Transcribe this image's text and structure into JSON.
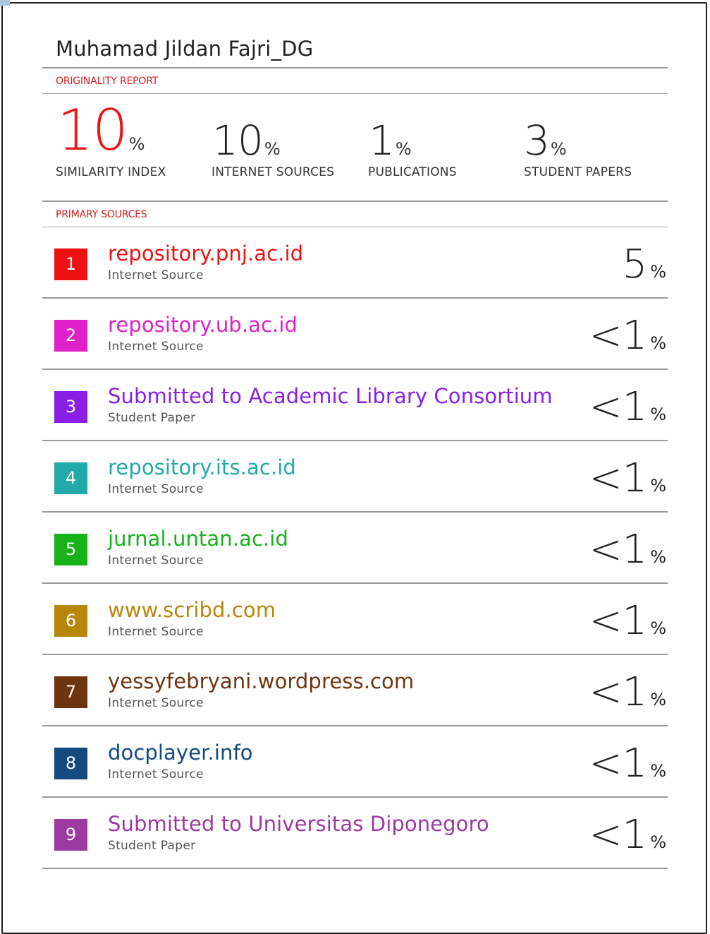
{
  "title": "Muhamad Jildan Fajri_DG",
  "originality_label": "ORIGINALITY REPORT",
  "stats": [
    {
      "value": "10",
      "unit": "%",
      "label": "SIMILARITY INDEX"
    },
    {
      "value": "10",
      "unit": "%",
      "label": "INTERNET SOURCES"
    },
    {
      "value": "1",
      "unit": "%",
      "label": "PUBLICATIONS"
    },
    {
      "value": "3",
      "unit": "%",
      "label": "STUDENT PAPERS"
    }
  ],
  "primary_label": "PRIMARY SOURCES",
  "sources": [
    {
      "num": "1",
      "name": "repository.pnj.ac.id",
      "type": "Internet Source",
      "value": "5",
      "unit": "%",
      "color": "#ee1111"
    },
    {
      "num": "2",
      "name": "repository.ub.ac.id",
      "type": "Internet Source",
      "value": "<1",
      "unit": "%",
      "color": "#e020c8"
    },
    {
      "num": "3",
      "name": "Submitted to Academic Library Consortium",
      "type": "Student Paper",
      "value": "<1",
      "unit": "%",
      "color": "#8a1ee6"
    },
    {
      "num": "4",
      "name": "repository.its.ac.id",
      "type": "Internet Source",
      "value": "<1",
      "unit": "%",
      "color": "#22aaaa"
    },
    {
      "num": "5",
      "name": "jurnal.untan.ac.id",
      "type": "Internet Source",
      "value": "<1",
      "unit": "%",
      "color": "#16b21a"
    },
    {
      "num": "6",
      "name": "www.scribd.com",
      "type": "Internet Source",
      "value": "<1",
      "unit": "%",
      "color": "#b8860b"
    },
    {
      "num": "7",
      "name": "yessyfebryani.wordpress.com",
      "type": "Internet Source",
      "value": "<1",
      "unit": "%",
      "color": "#6e3410"
    },
    {
      "num": "8",
      "name": "docplayer.info",
      "type": "Internet Source",
      "value": "<1",
      "unit": "%",
      "color": "#144a80"
    },
    {
      "num": "9",
      "name": "Submitted to Universitas Diponegoro",
      "type": "Student Paper",
      "value": "<1",
      "unit": "%",
      "color": "#9c3aa2"
    }
  ],
  "colors": {
    "accent_red": "#ea1515",
    "label_red": "#d42020"
  }
}
